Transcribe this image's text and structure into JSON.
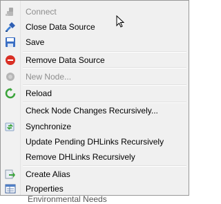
{
  "menu": {
    "connect": "Connect",
    "close_data_source": "Close Data Source",
    "save": "Save",
    "remove_data_source": "Remove Data Source",
    "new_node": "New Node...",
    "reload": "Reload",
    "check_node_changes": "Check Node Changes Recursively...",
    "synchronize": "Synchronize",
    "update_pending_dhlinks": "Update Pending DHLinks Recursively",
    "remove_dhlinks": "Remove DHLinks Recursively",
    "create_alias": "Create Alias",
    "properties": "Properties"
  },
  "background_text": "Environmental Needs"
}
